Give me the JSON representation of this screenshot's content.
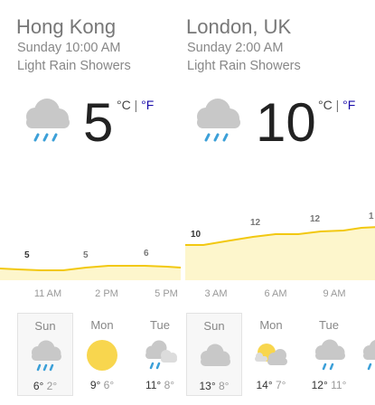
{
  "panels": [
    {
      "city": "Hong Kong",
      "time": "Sunday 10:00 AM",
      "condition": "Light Rain Showers",
      "temp": "5",
      "unit_c": "°C",
      "unit_sep": "|",
      "unit_f": "°F",
      "current_icon": "rain-cloud-icon",
      "chart_labels": [
        "5",
        "5",
        "6"
      ],
      "hours": [
        "11 AM",
        "2 PM",
        "5 PM"
      ],
      "days": [
        {
          "name": "Sun",
          "hi": "6°",
          "lo": "2°",
          "icon": "rain-cloud-icon",
          "selected": true
        },
        {
          "name": "Mon",
          "hi": "9°",
          "lo": "6°",
          "icon": "sun-icon"
        },
        {
          "name": "Tue",
          "hi": "11°",
          "lo": "8°",
          "icon": "rain-cloud-icon"
        }
      ]
    },
    {
      "city": "London, UK",
      "time": "Sunday 2:00 AM",
      "condition": "Light Rain Showers",
      "temp": "10",
      "unit_c": "°C",
      "unit_sep": "|",
      "unit_f": "°F",
      "current_icon": "rain-cloud-icon",
      "chart_labels": [
        "10",
        "12",
        "12",
        "1"
      ],
      "hours": [
        "3 AM",
        "6 AM",
        "9 AM"
      ],
      "days": [
        {
          "name": "Sun",
          "hi": "13°",
          "lo": "8°",
          "icon": "cloud-icon",
          "selected": true
        },
        {
          "name": "Mon",
          "hi": "14°",
          "lo": "7°",
          "icon": "partly-cloudy-icon"
        },
        {
          "name": "Tue",
          "hi": "12°",
          "lo": "11°",
          "icon": "rain-cloud-icon"
        },
        {
          "name": "",
          "hi": "",
          "lo": "",
          "icon": "rain-cloud-icon"
        }
      ]
    }
  ],
  "colors": {
    "chart_fill": "#fdf6cc",
    "chart_line": "#f2c811",
    "sun": "#f8d64e",
    "cloud": "#c8c8c8",
    "rain": "#3ca0d8",
    "fahrenheit_link": "#1a0dab"
  }
}
